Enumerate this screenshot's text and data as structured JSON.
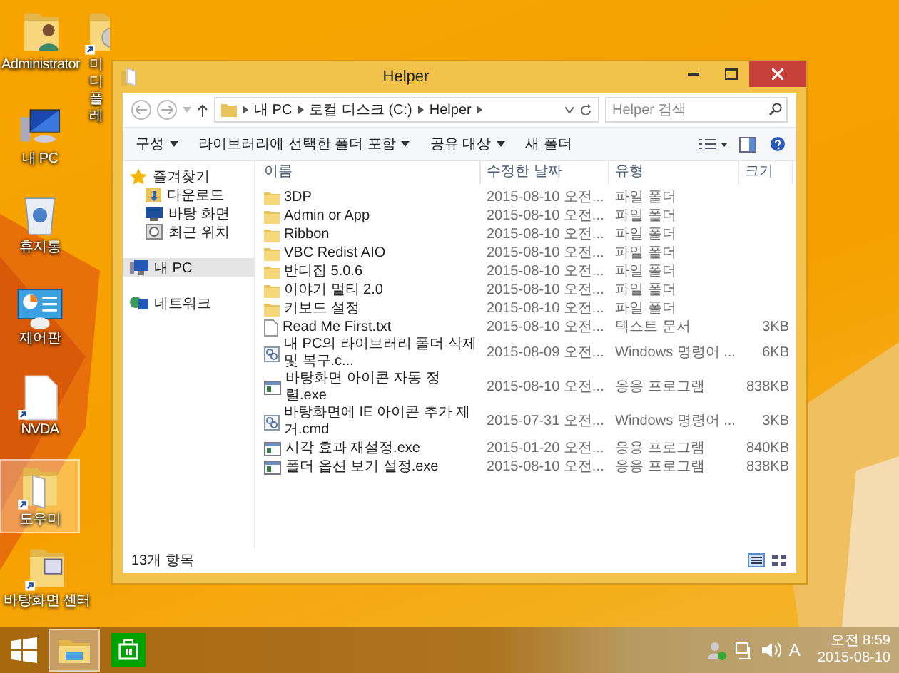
{
  "desktop_icons": [
    {
      "label": "Administrator",
      "kind": "user-folder",
      "selected": false
    },
    {
      "label": "미디 플레",
      "kind": "media-folder",
      "selected": false
    },
    {
      "label": "내 PC",
      "kind": "pc",
      "selected": false
    },
    {
      "label": "휴지통",
      "kind": "bin",
      "selected": false
    },
    {
      "label": "제어판",
      "kind": "control",
      "selected": false
    },
    {
      "label": "NVDA",
      "kind": "file",
      "selected": false
    },
    {
      "label": "도우미",
      "kind": "folder",
      "selected": true
    },
    {
      "label": "바탕화면 센터",
      "kind": "folder-doc",
      "selected": false
    }
  ],
  "window": {
    "title": "Helper",
    "address": [
      "내 PC",
      "로컬 디스크 (C:)",
      "Helper"
    ],
    "search": {
      "placeholder": "Helper 검색"
    },
    "toolbar": [
      "구성",
      "라이브러리에 선택한 폴더 포함",
      "공유 대상",
      "새 폴더"
    ],
    "toolbar_menus": [
      true,
      true,
      true,
      false
    ],
    "navigation": [
      {
        "label": "즐겨찾기",
        "kind": "star",
        "selected": false,
        "children": [
          {
            "label": "다운로드",
            "kind": "download",
            "selected": false
          },
          {
            "label": "바탕 화면",
            "kind": "desktop",
            "selected": false
          },
          {
            "label": "최근 위치",
            "kind": "recent",
            "selected": false
          }
        ]
      },
      {
        "label": "내 PC",
        "kind": "pc",
        "selected": true
      },
      {
        "label": "네트워크",
        "kind": "network",
        "selected": false
      }
    ],
    "columns": [
      "이름",
      "수정한 날짜",
      "유형",
      "크기"
    ],
    "rows": [
      {
        "kind": "folder",
        "name": "3DP",
        "date": "2015-08-10 오전...",
        "type": "파일 폴더",
        "size": ""
      },
      {
        "kind": "folder",
        "name": "Admin or App",
        "date": "2015-08-10 오전...",
        "type": "파일 폴더",
        "size": ""
      },
      {
        "kind": "folder",
        "name": "Ribbon",
        "date": "2015-08-10 오전...",
        "type": "파일 폴더",
        "size": ""
      },
      {
        "kind": "folder",
        "name": "VBC Redist AIO",
        "date": "2015-08-10 오전...",
        "type": "파일 폴더",
        "size": ""
      },
      {
        "kind": "folder",
        "name": "반디집 5.0.6",
        "date": "2015-08-10 오전...",
        "type": "파일 폴더",
        "size": ""
      },
      {
        "kind": "folder",
        "name": "이야기 멀티 2.0",
        "date": "2015-08-10 오전...",
        "type": "파일 폴더",
        "size": ""
      },
      {
        "kind": "folder",
        "name": "키보드 설정",
        "date": "2015-08-10 오전...",
        "type": "파일 폴더",
        "size": ""
      },
      {
        "kind": "text",
        "name": "Read Me First.txt",
        "date": "2015-08-10 오전...",
        "type": "텍스트 문서",
        "size": "3KB"
      },
      {
        "kind": "script",
        "name": "내 PC의 라이브러리 폴더 삭제 및 복구.c...",
        "date": "2015-08-09 오전...",
        "type": "Windows 명령어 ...",
        "size": "6KB"
      },
      {
        "kind": "exe",
        "name": "바탕화면 아이콘 자동 정렬.exe",
        "date": "2015-08-10 오전...",
        "type": "응용 프로그램",
        "size": "838KB"
      },
      {
        "kind": "script",
        "name": "바탕화면에 IE 아이콘 추가 제거.cmd",
        "date": "2015-07-31 오전...",
        "type": "Windows 명령어 ...",
        "size": "3KB"
      },
      {
        "kind": "exe",
        "name": "시각 효과 재설정.exe",
        "date": "2015-01-20 오전...",
        "type": "응용 프로그램",
        "size": "840KB"
      },
      {
        "kind": "exe",
        "name": "폴더 옵션 보기 설정.exe",
        "date": "2015-08-10 오전...",
        "type": "응용 프로그램",
        "size": "838KB"
      }
    ],
    "status_bar": "13개 항목"
  },
  "taskbar": {
    "apps": [
      {
        "kind": "explorer",
        "selected": true
      },
      {
        "kind": "store",
        "selected": false
      }
    ],
    "ime": "A",
    "time": "오전 8:59",
    "date": "2015-08-10"
  }
}
